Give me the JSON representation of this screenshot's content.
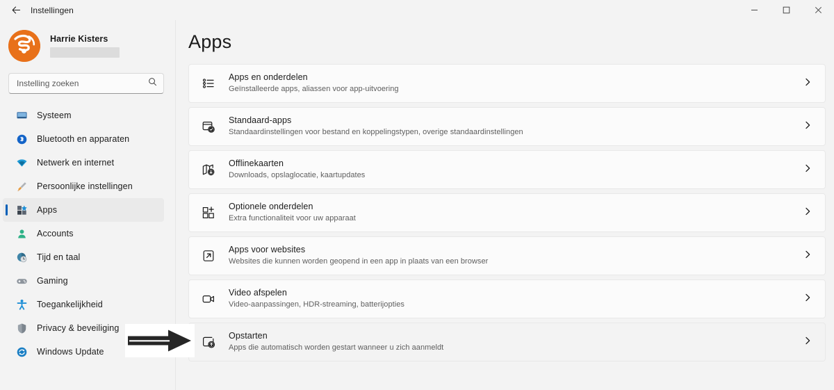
{
  "window": {
    "title": "Instellingen",
    "back_icon": "back-arrow-icon",
    "controls": {
      "minimize": "−",
      "maximize": "☐",
      "close": "✕"
    }
  },
  "profile": {
    "name": "Harrie Kisters",
    "redacted_field": ""
  },
  "search": {
    "placeholder": "Instelling zoeken",
    "value": "",
    "icon": "search-icon"
  },
  "sidebar": {
    "items": [
      {
        "label": "Systeem",
        "icon": "monitor-icon",
        "selected": false
      },
      {
        "label": "Bluetooth en apparaten",
        "icon": "bluetooth-icon",
        "selected": false
      },
      {
        "label": "Netwerk en internet",
        "icon": "wifi-icon",
        "selected": false
      },
      {
        "label": "Persoonlijke instellingen",
        "icon": "paintbrush-icon",
        "selected": false
      },
      {
        "label": "Apps",
        "icon": "apps-grid-icon",
        "selected": true
      },
      {
        "label": "Accounts",
        "icon": "person-icon",
        "selected": false
      },
      {
        "label": "Tijd en taal",
        "icon": "clock-globe-icon",
        "selected": false
      },
      {
        "label": "Gaming",
        "icon": "gamepad-icon",
        "selected": false
      },
      {
        "label": "Toegankelijkheid",
        "icon": "accessibility-icon",
        "selected": false
      },
      {
        "label": "Privacy & beveiliging",
        "icon": "shield-icon",
        "selected": false
      },
      {
        "label": "Windows Update",
        "icon": "update-refresh-icon",
        "selected": false
      }
    ]
  },
  "main": {
    "page_title": "Apps",
    "cards": [
      {
        "title": "Apps en onderdelen",
        "subtitle": "Geïnstalleerde apps, aliassen voor app-uitvoering",
        "icon": "bulleted-list-icon",
        "hovered": false
      },
      {
        "title": "Standaard-apps",
        "subtitle": "Standaardinstellingen voor bestand en koppelingstypen, overige standaardinstellingen",
        "icon": "app-default-check-icon",
        "hovered": false
      },
      {
        "title": "Offlinekaarten",
        "subtitle": "Downloads, opslaglocatie, kaartupdates",
        "icon": "map-download-icon",
        "hovered": false
      },
      {
        "title": "Optionele onderdelen",
        "subtitle": "Extra functionaliteit voor uw apparaat",
        "icon": "grid-plus-icon",
        "hovered": false
      },
      {
        "title": "Apps voor websites",
        "subtitle": "Websites die kunnen worden geopend in een app in plaats van een browser",
        "icon": "external-link-icon",
        "hovered": false
      },
      {
        "title": "Video afspelen",
        "subtitle": "Video-aanpassingen, HDR-streaming, batterijopties",
        "icon": "video-camera-icon",
        "hovered": false
      },
      {
        "title": "Opstarten",
        "subtitle": "Apps die automatisch worden gestart wanneer u zich aanmeldt",
        "icon": "startup-power-icon",
        "hovered": true
      }
    ],
    "chevron_icon": "chevron-right-icon"
  },
  "annotation": {
    "icon": "pointing-arrow-icon",
    "points_to": "Opstarten"
  },
  "colors": {
    "accent": "#005fb8",
    "window_bg": "#f3f3f3",
    "card_bg": "#fbfbfb",
    "card_border": "#e8e8e8",
    "avatar_bg": "#e8711a",
    "text_primary": "#1b1b1b",
    "text_secondary": "#5e5e5e"
  }
}
